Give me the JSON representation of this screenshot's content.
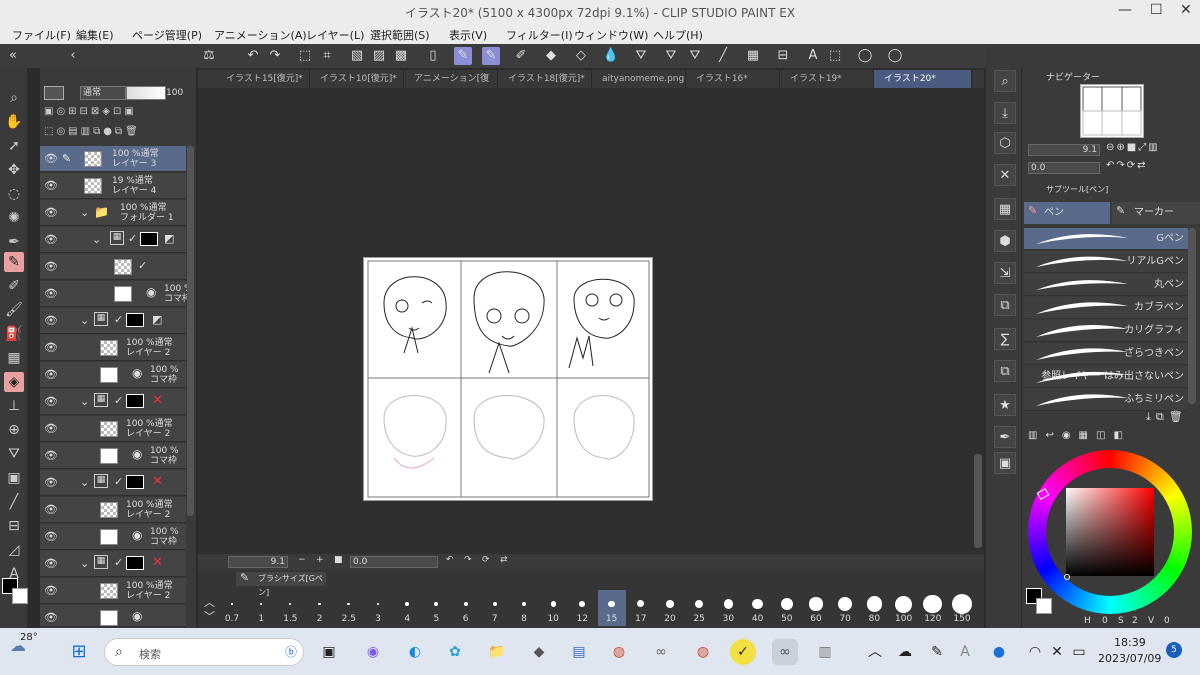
{
  "window": {
    "title": "イラスト20* (5100 x 4300px 72dpi 9.1%)  - CLIP STUDIO PAINT EX",
    "min": "—",
    "max": "☐",
    "close": "✕"
  },
  "menu": [
    "ファイル(F)",
    "編集(E)",
    "ページ管理(P)",
    "アニメーション(A)",
    "レイヤー(L)",
    "選択範囲(S)",
    "表示(V)",
    "フィルター(I)",
    "ウィンドウ(W)",
    "ヘルプ(H)"
  ],
  "layer_panel": {
    "blend_mode": "通常",
    "opacity": "100",
    "layers": [
      {
        "pct": "100 %通常",
        "name": "レイヤー 3"
      },
      {
        "pct": "19 %通常",
        "name": "レイヤー 4"
      },
      {
        "pct": "100 %通常",
        "name": "フォルダー 1"
      },
      {
        "pct": "100 %通常",
        "name": "レイヤー 2"
      },
      {
        "pct": "100 %通常",
        "name": "レイヤー 2"
      },
      {
        "pct": "100 %通常",
        "name": "レイヤー 2"
      },
      {
        "pct": "100 %通常",
        "name": "レイヤー 2"
      },
      {
        "pct": "100 %",
        "name": "コマ枠"
      }
    ]
  },
  "tabs": [
    "イラスト15[復元]*",
    "イラスト10[復元]*",
    "アニメーション[復元]",
    "イラスト18[復元]*",
    "aityanomeme.png",
    "イラスト16*",
    "イラスト19*",
    "イラスト20*"
  ],
  "status": {
    "zoom": "9.1",
    "coords": "0.0"
  },
  "brush_size": {
    "title": "ブラシサイズ[Gペン]",
    "sizes": [
      "0.7",
      "1",
      "1.5",
      "2",
      "2.5",
      "3",
      "4",
      "5",
      "6",
      "7",
      "8",
      "10",
      "12",
      "15",
      "17",
      "20",
      "25",
      "30",
      "40",
      "50",
      "60",
      "70",
      "80",
      "100",
      "120",
      "150"
    ],
    "selected": "15"
  },
  "navigator": {
    "title": "ナビゲーター",
    "zoom": "9.1",
    "angle": "0.0"
  },
  "subtool": {
    "title": "サブツール[ペン]",
    "groups": [
      "ペン",
      "マーカー"
    ],
    "pens": [
      "Gペン",
      "リアルGペン",
      "丸ペン",
      "カブラペン",
      "カリグラフィ",
      "ざらつきペン",
      "参照レイヤー はみ出さないペン",
      "ふちミリペン"
    ],
    "selected": "Gペン"
  },
  "color": {
    "h_label": "H",
    "h": "0",
    "s_label": "S",
    "s": "2",
    "v_label": "V",
    "v": "0",
    "main": "#000000",
    "sub": "#ffffff"
  },
  "taskbar": {
    "weather": "28°",
    "search": "検索",
    "time": "18:39",
    "date": "2023/07/09",
    "notif": "5"
  }
}
